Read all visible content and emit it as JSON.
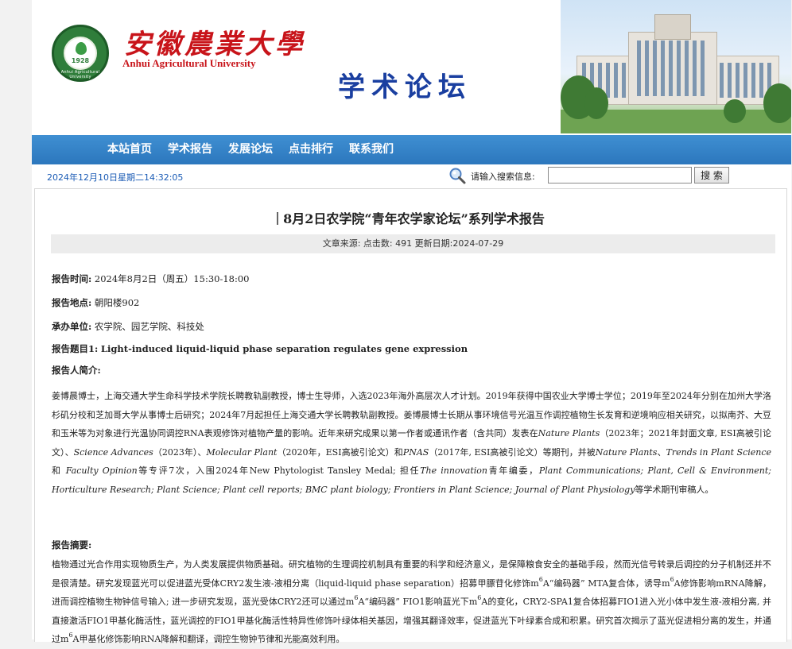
{
  "header": {
    "uni_name_cn": "安徽農業大學",
    "uni_name_en": "Anhui Agricultural University",
    "logo_year": "1928",
    "logo_ring_text": "Anhui Agricultural University",
    "forum_title": "学术论坛"
  },
  "nav": {
    "items": [
      "本站首页",
      "学术报告",
      "发展论坛",
      "点击排行",
      "联系我们"
    ]
  },
  "topbar": {
    "datetime": "2024年12月10日星期二14:32:05",
    "search_label": "请输入搜索信息:",
    "search_value": "",
    "search_button": "搜 索"
  },
  "article": {
    "title": "8月2日农学院“青年农学家论坛”系列学术报告",
    "meta": "文章来源: 点击数: 491 更新日期:2024-07-29",
    "fields": [
      {
        "label": "报告时间:",
        "value": "2024年8月2日（周五）15:30-18:00"
      },
      {
        "label": "报告地点:",
        "value": "朝阳楼902"
      },
      {
        "label": "承办单位:",
        "value": "农学院、园艺学院、科技处"
      },
      {
        "label": "报告题目1:",
        "value": "Light-induced liquid-liquid phase separation regulates gene expression"
      },
      {
        "label": "报告人简介:",
        "value": ""
      }
    ],
    "bio": {
      "p1": "姜博晨博士，上海交通大学生命科学技术学院长聘教轨副教授，博士生导师，入选2023年海外高层次人才计划。2019年获得中国农业大学博士学位；2019年至2024年分别在加州大学洛杉矶分校和芝加哥大学从事博士后研究；2024年7月起担任上海交通大学长聘教轨副教授。姜博晨博士长期从事环境信号光温互作调控植物生长发育和逆境响应相关研究，以拟南芥、大豆和玉米等为对象进行光温协同调控RNA表观修饰对植物产量的影响。近年来研究成果以第一作者或通讯作者（含共同）发表在",
      "j1": "Nature Plants",
      "p2": "（2023年；2021年封面文章, ESI高被引论文）、",
      "j2": "Science Advances",
      "p3": "（2023年）、",
      "j3": "Molecular Plant",
      "p4": "（2020年，ESI高被引论文）和",
      "j4": "PNAS",
      "p5": "（2017年, ESI高被引论文）等期刊，并被",
      "j5": "Nature Plants",
      "p6": "、",
      "j6": "Trends in Plant Science",
      "p7": "和 ",
      "j7": "Faculty Opinion",
      "p8": "等专评7次，入围2024年New Phytologist Tansley Medal; 担任",
      "j8": "The innovation",
      "p9": "青年编委，",
      "j9": "Plant Communications; Plant, Cell & Environment; Horticulture Research; Plant Science; Plant cell reports; BMC plant biology; Frontiers in Plant Science; Journal of Plant Physiology",
      "p10": "等学术期刊审稿人。"
    },
    "abstract_label": "报告摘要:",
    "abstract": {
      "a1": "植物通过光合作用实现物质生产，为人类发展提供物质基础。研究植物的生理调控机制具有重要的科学和经济意义，是保障粮食安全的基础手段，然而光信号转录后调控的分子机制还并不是很清楚。研究发现蓝光可以促进蓝光受体CRY2发生液-液相分离（liquid-liquid phase separation）招募甲膘苷化修饰m",
      "s1": "6",
      "a2": "A“编码器” MTA复合体，诱导m",
      "s2": "6",
      "a3": "A修饰影响mRNA降解，进而调控植物生物钟信号输入; 进一步研究发现，蓝光受体CRY2还可以通过m",
      "s3": "6",
      "a4": "A“编码器” FIO1影响蓝光下m",
      "s4": "6",
      "a5": "A的变化，CRY2-SPA1复合体招募FIO1进入光小体中发生液-液相分离, 并直接激活FIO1甲基化酶活性，蓝光调控的FIO1甲基化酶活性特异性修饰叶绿体相关基因，增强其翻译效率，促进蓝光下叶绿素合成和积累。研究首次揭示了蓝光促进相分离的发生，并通过m",
      "s5": "6",
      "a6": "A甲基化修饰影响RNA降解和翻译，调控生物钟节律和光能高效利用。"
    }
  }
}
